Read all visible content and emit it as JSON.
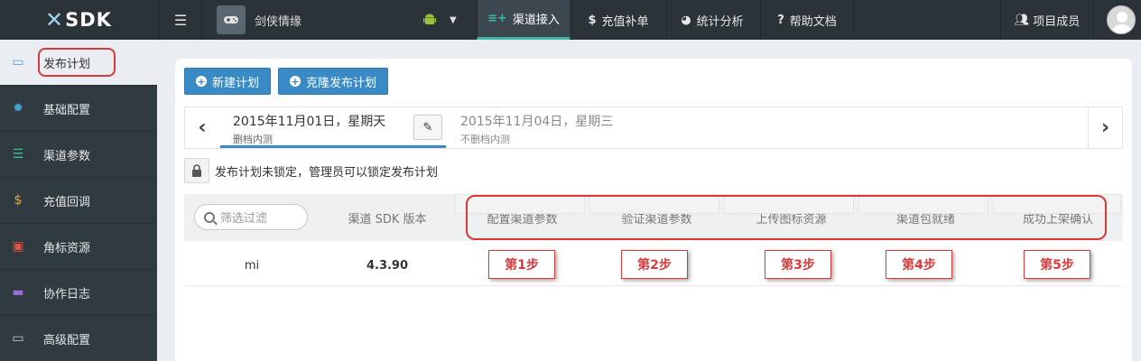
{
  "topbar": {
    "logo": "SDK",
    "game_name": "剑侠情缘",
    "nav": [
      {
        "label": "渠道接入",
        "icon": "≡+"
      },
      {
        "label": "充值补单",
        "icon": "$"
      },
      {
        "label": "统计分析",
        "icon": "◕"
      },
      {
        "label": "帮助文档",
        "icon": "?"
      }
    ],
    "members_label": "项目成员"
  },
  "sidebar": {
    "items": [
      {
        "label": "发布计划",
        "icon": "calendar-icon"
      },
      {
        "label": "基础配置",
        "icon": "gear-icon"
      },
      {
        "label": "渠道参数",
        "icon": "list-icon"
      },
      {
        "label": "充值回调",
        "icon": "dollar-icon"
      },
      {
        "label": "角标资源",
        "icon": "image-icon"
      },
      {
        "label": "协作日志",
        "icon": "chat-icon"
      },
      {
        "label": "高级配置",
        "icon": "laptop-icon"
      }
    ]
  },
  "actions": {
    "new_plan": "新建计划",
    "clone_plan": "克隆发布计划"
  },
  "dates": [
    {
      "date": "2015年11月01日，星期天",
      "sub": "删档内测"
    },
    {
      "date": "2015年11月04日，星期三",
      "sub": "不删档内测"
    }
  ],
  "lock_text": "发布计划未锁定，管理员可以锁定发布计划",
  "table": {
    "search_placeholder": "筛选过滤",
    "headers": [
      "渠道 SDK 版本",
      "配置渠道参数",
      "验证渠道参数",
      "上传图标资源",
      "渠道包就绪",
      "成功上架确认"
    ],
    "row": {
      "channel": "mi",
      "version": "4.3.90"
    }
  },
  "steps": [
    "第1步",
    "第2步",
    "第3步",
    "第4步",
    "第5步"
  ],
  "colors": {
    "accent": "#3a8ac6",
    "active_nav": "#42b6a9",
    "annotation": "#d63a3a"
  }
}
